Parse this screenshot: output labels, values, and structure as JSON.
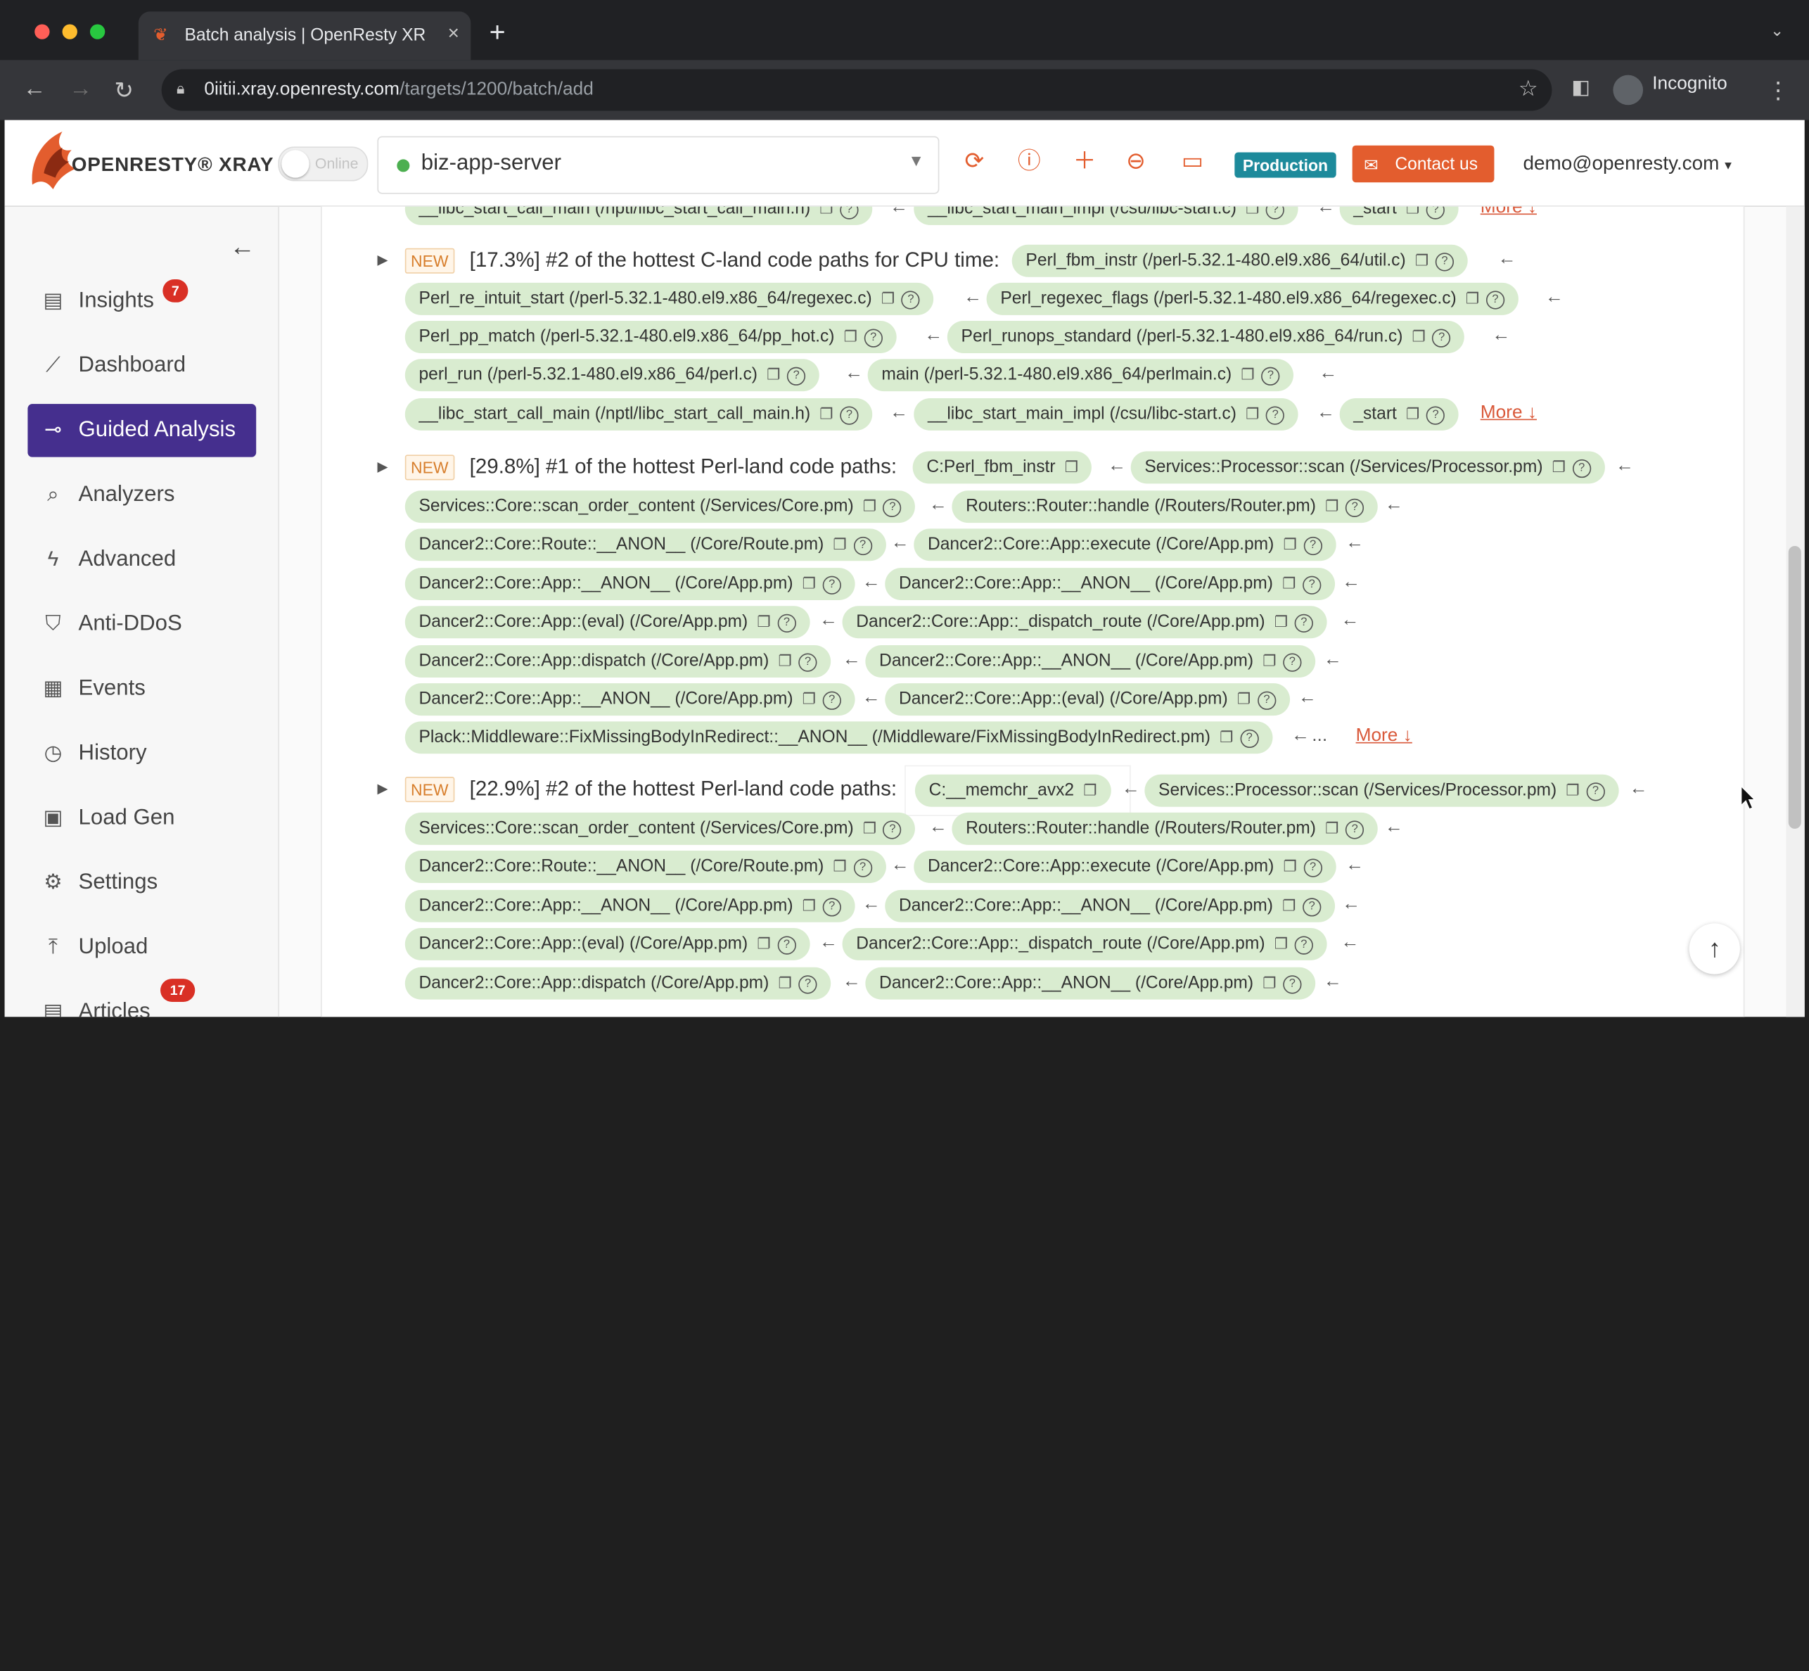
{
  "browser": {
    "tab_title": "Batch analysis | OpenResty XR",
    "tab_close": "×",
    "new_tab": "+",
    "url_host": "0iitii.xray.openresty.com",
    "url_path": "/targets/1200/batch/add",
    "incognito_label": "Incognito"
  },
  "header": {
    "logo_text": "OPENRESTY® XRAY",
    "online_label": "Online",
    "app_name": "biz-app-server",
    "env_badge": "Production",
    "contact_label": "Contact us",
    "user": "demo@openresty.com"
  },
  "sidebar": {
    "items": [
      {
        "label": "Insights",
        "icon": "document-icon",
        "badge": "7"
      },
      {
        "label": "Dashboard",
        "icon": "chart-icon"
      },
      {
        "label": "Guided Analysis",
        "icon": "guided-icon"
      },
      {
        "label": "Analyzers",
        "icon": "search-icon"
      },
      {
        "label": "Advanced",
        "icon": "bolt-icon"
      },
      {
        "label": "Anti-DDoS",
        "icon": "shield-icon"
      },
      {
        "label": "Events",
        "icon": "calendar-icon"
      },
      {
        "label": "History",
        "icon": "clock-icon"
      },
      {
        "label": "Load Gen",
        "icon": "loadgen-icon"
      },
      {
        "label": "Settings",
        "icon": "gear-icon"
      },
      {
        "label": "Upload",
        "icon": "upload-icon"
      },
      {
        "label": "Articles",
        "icon": "article-icon",
        "badge": "17"
      }
    ]
  },
  "main": {
    "top_partial": [
      "__libc_start_call_main (/nptl/libc_start_call_main.h)",
      "__libc_start_main_impl (/csu/libc-start.c)",
      "_start"
    ],
    "sections": [
      {
        "badge": "NEW",
        "headline": "[17.3%] #2 of the hottest C-land code paths for CPU time:",
        "more": "More ↓",
        "frames": [
          "Perl_fbm_instr (/perl-5.32.1-480.el9.x86_64/util.c)",
          "Perl_re_intuit_start (/perl-5.32.1-480.el9.x86_64/regexec.c)",
          "Perl_regexec_flags (/perl-5.32.1-480.el9.x86_64/regexec.c)",
          "Perl_pp_match (/perl-5.32.1-480.el9.x86_64/pp_hot.c)",
          "Perl_runops_standard (/perl-5.32.1-480.el9.x86_64/run.c)",
          "perl_run (/perl-5.32.1-480.el9.x86_64/perl.c)",
          "main (/perl-5.32.1-480.el9.x86_64/perlmain.c)",
          "__libc_start_call_main (/nptl/libc_start_call_main.h)",
          "__libc_start_main_impl (/csu/libc-start.c)",
          "_start"
        ]
      },
      {
        "badge": "NEW",
        "headline": "[29.8%] #1 of the hottest Perl-land code paths:",
        "more": "More ↓",
        "ellipsis": "...",
        "frames": [
          "C:Perl_fbm_instr",
          "Services::Processor::scan (/Services/Processor.pm)",
          "Services::Core::scan_order_content (/Services/Core.pm)",
          "Routers::Router::handle (/Routers/Router.pm)",
          "Dancer2::Core::Route::__ANON__ (/Core/Route.pm)",
          "Dancer2::Core::App::execute (/Core/App.pm)",
          "Dancer2::Core::App::__ANON__ (/Core/App.pm)",
          "Dancer2::Core::App::__ANON__ (/Core/App.pm)",
          "Dancer2::Core::App::(eval) (/Core/App.pm)",
          "Dancer2::Core::App::_dispatch_route (/Core/App.pm)",
          "Dancer2::Core::App::dispatch (/Core/App.pm)",
          "Dancer2::Core::App::__ANON__ (/Core/App.pm)",
          "Dancer2::Core::App::__ANON__ (/Core/App.pm)",
          "Dancer2::Core::App::(eval) (/Core/App.pm)",
          "Plack::Middleware::FixMissingBodyInRedirect::__ANON__ (/Middleware/FixMissingBodyInRedirect.pm)"
        ]
      },
      {
        "badge": "NEW",
        "headline": "[22.9%] #2 of the hottest Perl-land code paths:",
        "frames": [
          "C:__memchr_avx2",
          "Services::Processor::scan (/Services/Processor.pm)",
          "Services::Core::scan_order_content (/Services/Core.pm)",
          "Routers::Router::handle (/Routers/Router.pm)",
          "Dancer2::Core::Route::__ANON__ (/Core/Route.pm)",
          "Dancer2::Core::App::execute (/Core/App.pm)",
          "Dancer2::Core::App::__ANON__ (/Core/App.pm)",
          "Dancer2::Core::App::__ANON__ (/Core/App.pm)",
          "Dancer2::Core::App::(eval) (/Core/App.pm)",
          "Dancer2::Core::App::_dispatch_route (/Core/App.pm)",
          "Dancer2::Core::App::dispatch (/Core/App.pm)",
          "Dancer2::Core::App::__ANON__ (/Core/App.pm)"
        ]
      }
    ]
  },
  "colors": {
    "accent": "#452f8e",
    "brand": "#e35d2e",
    "frame_pill": "#d9ecd0",
    "env_badge": "#1d8a9b"
  }
}
